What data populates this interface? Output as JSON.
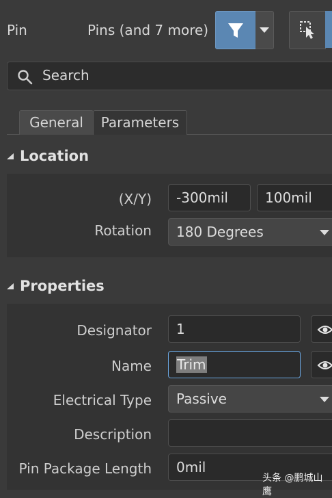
{
  "header": {
    "object_type": "Pin",
    "selection_summary": "Pins (and 7 more)"
  },
  "search": {
    "placeholder": "Search"
  },
  "tabs": [
    {
      "label": "General",
      "active": true
    },
    {
      "label": "Parameters",
      "active": false
    }
  ],
  "location": {
    "section_title": "Location",
    "xy_label": "(X/Y)",
    "x_value": "-300mil",
    "y_value": "100mil",
    "rotation_label": "Rotation",
    "rotation_value": "180 Degrees"
  },
  "properties": {
    "section_title": "Properties",
    "designator_label": "Designator",
    "designator_value": "1",
    "name_label": "Name",
    "name_value": "Trim",
    "electrical_type_label": "Electrical Type",
    "electrical_type_value": "Passive",
    "description_label": "Description",
    "description_value": "",
    "pin_package_length_label": "Pin Package Length",
    "pin_package_length_value": "0mil"
  },
  "watermark": "头条 @鹏城山鹰",
  "colors": {
    "background": "#3a3a3a",
    "accent": "#5b87b3",
    "focus_border": "#6aa6e0",
    "field_bg": "#2a2a2a"
  }
}
